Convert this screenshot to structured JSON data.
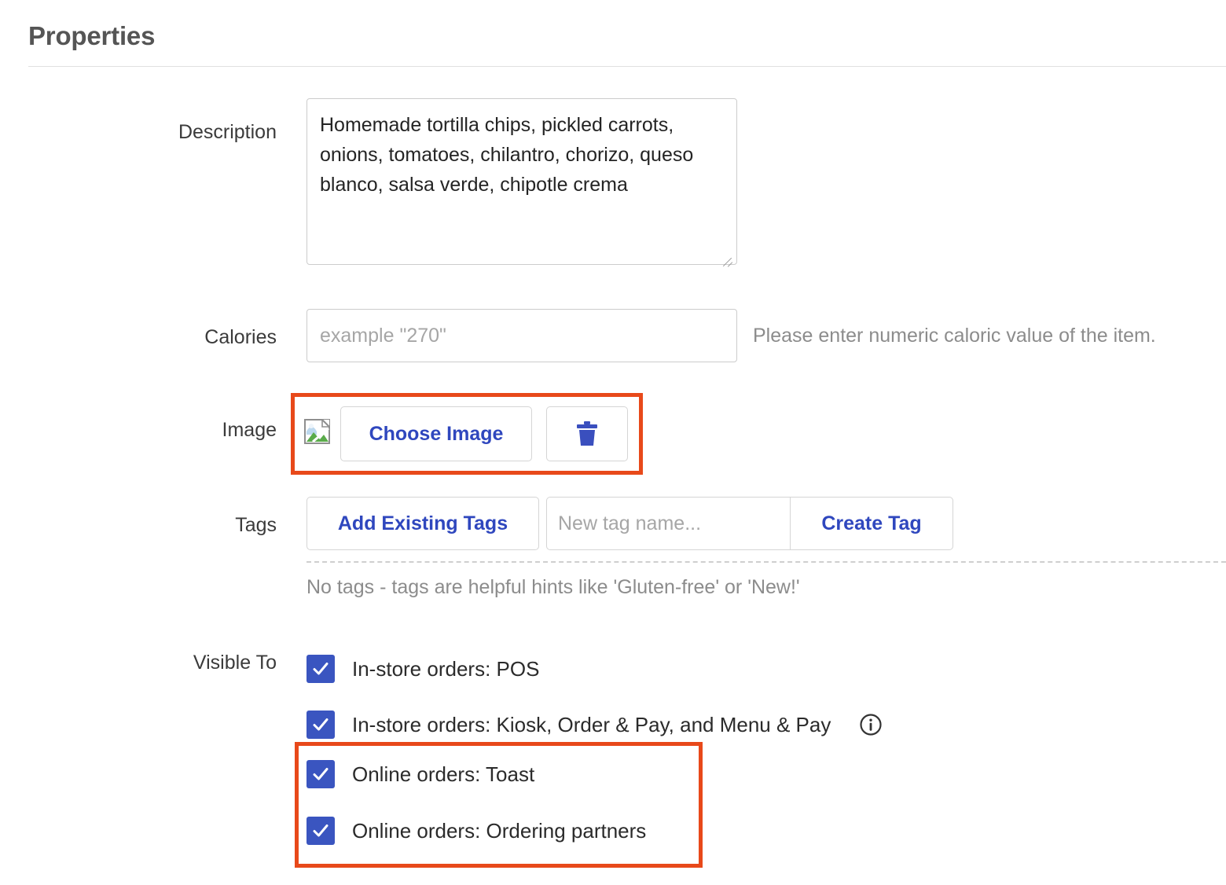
{
  "header": {
    "title": "Properties"
  },
  "fields": {
    "description": {
      "label": "Description",
      "value": "Homemade tortilla chips, pickled carrots, onions, tomatoes, chilantro, chorizo, queso blanco, salsa verde, chipotle crema"
    },
    "calories": {
      "label": "Calories",
      "value": "",
      "placeholder": "example \"270\"",
      "hint": "Please enter numeric caloric value of the item."
    },
    "image": {
      "label": "Image",
      "choose_label": "Choose Image",
      "delete_icon": "trash-icon",
      "thumbnail_icon": "broken-image-icon",
      "highlight_color": "#e8491a"
    },
    "tags": {
      "label": "Tags",
      "add_existing_label": "Add Existing Tags",
      "new_tag_placeholder": "New tag name...",
      "new_tag_value": "",
      "create_label": "Create Tag",
      "empty_note": "No tags - tags are helpful hints like 'Gluten-free' or 'New!'"
    },
    "visible_to": {
      "label": "Visible To",
      "options": [
        {
          "label": "In-store orders: POS",
          "checked": true,
          "info": false
        },
        {
          "label": "In-store orders: Kiosk, Order & Pay, and Menu & Pay",
          "checked": true,
          "info": true
        },
        {
          "label": "Online orders: Toast",
          "checked": true,
          "info": false
        },
        {
          "label": "Online orders: Ordering partners",
          "checked": true,
          "info": false
        }
      ],
      "highlight_color": "#e8491a"
    }
  },
  "colors": {
    "accent_blue": "#2f47be",
    "checkbox_blue": "#3a55c0",
    "highlight_orange": "#e8491a",
    "title_gray": "#555555",
    "muted_text": "#8c8c8c"
  }
}
